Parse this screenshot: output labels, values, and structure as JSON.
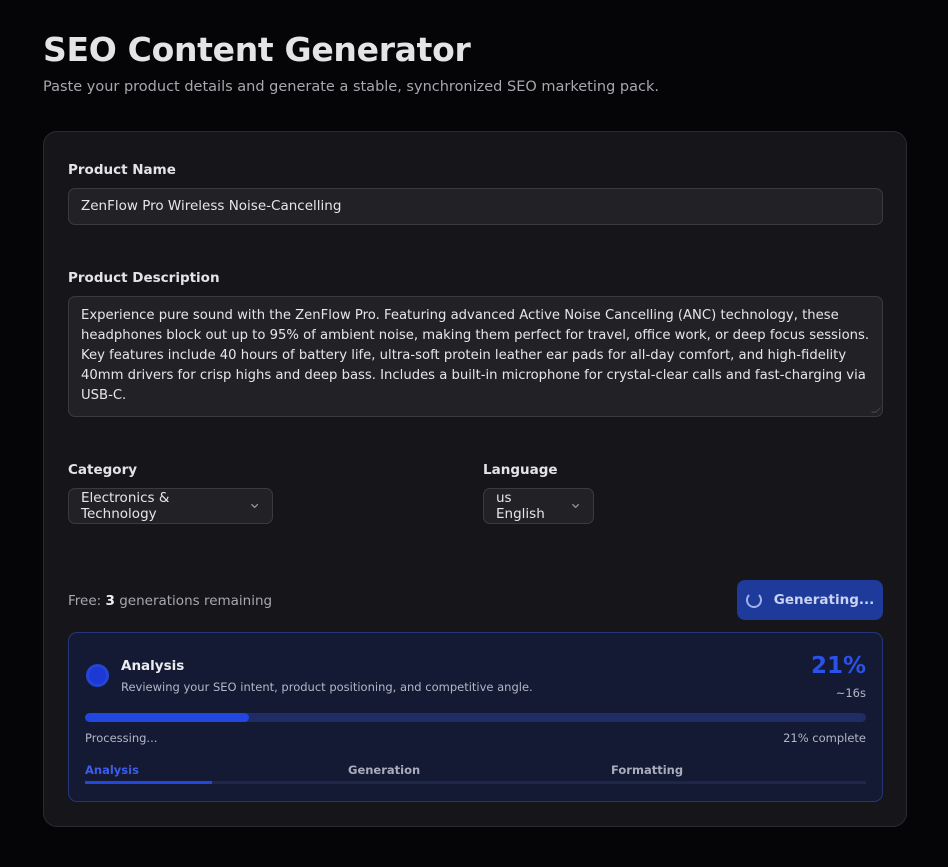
{
  "header": {
    "title": "SEO Content Generator",
    "subtitle": "Paste your product details and generate a stable, synchronized SEO marketing pack."
  },
  "form": {
    "product_name_label": "Product Name",
    "product_name_value": "ZenFlow Pro Wireless Noise-Cancelling",
    "description_label": "Product Description",
    "description_value": "Experience pure sound with the ZenFlow Pro. Featuring advanced Active Noise Cancelling (ANC) technology, these headphones block out up to 95% of ambient noise, making them perfect for travel, office work, or deep focus sessions. Key features include 40 hours of battery life, ultra-soft protein leather ear pads for all-day comfort, and high-fidelity 40mm drivers for crisp highs and deep bass. Includes a built-in microphone for crystal-clear calls and fast-charging via USB-C.",
    "category_label": "Category",
    "category_value": "Electronics & Technology",
    "language_label": "Language",
    "language_value": "us English"
  },
  "quota": {
    "prefix": "Free:",
    "count": "3",
    "suffix": "generations remaining"
  },
  "generate_button": {
    "label": "Generating..."
  },
  "progress": {
    "stage_title": "Analysis",
    "stage_description": "Reviewing your SEO intent, product positioning, and competitive angle.",
    "percent_label": "21%",
    "percent_value": 0.21,
    "eta": "~16s",
    "status_left": "Processing...",
    "status_right": "21% complete",
    "steps": [
      {
        "label": "Analysis",
        "active": true
      },
      {
        "label": "Generation",
        "active": false
      },
      {
        "label": "Formatting",
        "active": false
      }
    ]
  },
  "colors": {
    "accent": "#2147df",
    "button_bg": "#1e3a9a",
    "card_bg": "#16161a",
    "progress_bg": "#141a33"
  }
}
